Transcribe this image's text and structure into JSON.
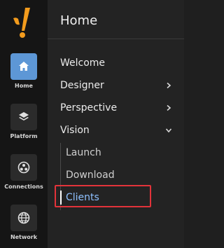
{
  "colors": {
    "accent": "#5d97d6",
    "active_link": "#8ec0ff",
    "highlight": "#e2333a"
  },
  "rail": {
    "items": [
      {
        "label": "Home",
        "icon": "home-icon",
        "active": true
      },
      {
        "label": "Platform",
        "icon": "layers-icon",
        "active": false
      },
      {
        "label": "Connections",
        "icon": "connections-icon",
        "active": false
      },
      {
        "label": "Network",
        "icon": "globe-icon",
        "active": false
      }
    ]
  },
  "panel": {
    "title": "Home",
    "items": [
      {
        "label": "Welcome",
        "expandable": false
      },
      {
        "label": "Designer",
        "expandable": true,
        "expanded": false
      },
      {
        "label": "Perspective",
        "expandable": true,
        "expanded": false
      },
      {
        "label": "Vision",
        "expandable": true,
        "expanded": true
      }
    ],
    "vision_sub": [
      {
        "label": "Launch",
        "selected": false
      },
      {
        "label": "Download",
        "selected": false
      },
      {
        "label": "Clients",
        "selected": true
      }
    ]
  }
}
